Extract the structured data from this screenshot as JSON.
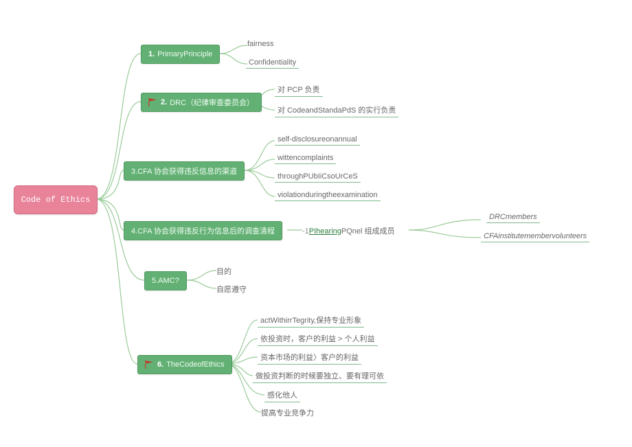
{
  "root": {
    "title": "Code of Ethics"
  },
  "branches": [
    {
      "num": "1.",
      "label": "PrimaryPrinciple",
      "children": [
        "fairness",
        "Confidentiality"
      ]
    },
    {
      "num": "2.",
      "label": "DRC（纪律审查委员会）",
      "children": [
        "对 PCP 负责",
        "对 CodeandStandaPdS 的实行负责"
      ]
    },
    {
      "label": "3.CFA 协会获得违反信息的渠道",
      "children": [
        "self-disclosureonannual",
        "wittencomplaints",
        "throughPUbIiCsoUrCeS",
        "violationduringtheexamination"
      ]
    },
    {
      "label": "4.CFA 协会获得违反行为信息后的调查清程",
      "sub": {
        "prefix": "-1",
        "link": "PIhearing",
        "suffix": "PQnel 组成成员"
      },
      "far": [
        "DRCmembers",
        "CFAinstitutemembervolunteers"
      ]
    },
    {
      "label": "5.AMC?",
      "children": [
        "目的",
        "自愿遵守"
      ]
    },
    {
      "num": "6.",
      "label": "TheCodeofEthics",
      "children": [
        "actWithirrTegrity,保持专业形象",
        "依投资时，客户的利益 > 个人利益",
        "资本市场的利益〉客户的利益",
        "做投资判断的时候要独立、要有理可依",
        "感化他人",
        "提高专业竞争力"
      ]
    }
  ]
}
